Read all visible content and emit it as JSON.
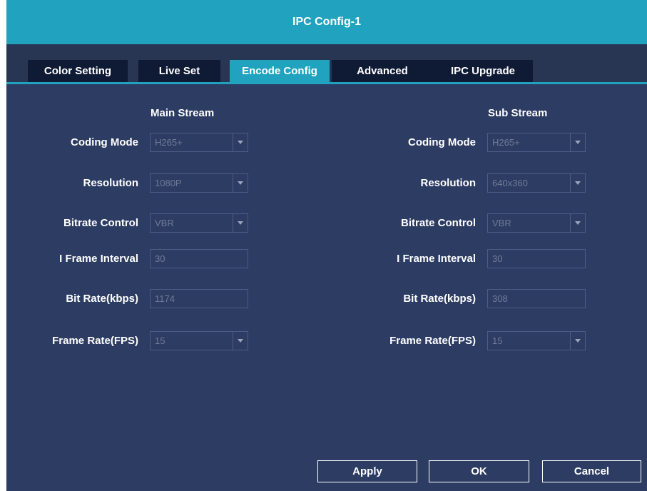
{
  "window": {
    "title": "IPC Config-1"
  },
  "tabs": [
    {
      "label": "Color Setting",
      "active": false
    },
    {
      "label": "Live Set",
      "active": false
    },
    {
      "label": "Encode Config",
      "active": true
    },
    {
      "label": "Advanced",
      "active": false
    },
    {
      "label": "IPC Upgrade",
      "active": false
    }
  ],
  "main": {
    "title": "Main Stream",
    "fields": [
      {
        "label": "Coding Mode",
        "value": "H265+",
        "kind": "select"
      },
      {
        "label": "Resolution",
        "value": "1080P",
        "kind": "select"
      },
      {
        "label": "Bitrate Control",
        "value": "VBR",
        "kind": "select"
      },
      {
        "label": "I Frame Interval",
        "value": "30",
        "kind": "input"
      },
      {
        "label": "Bit Rate(kbps)",
        "value": "1174",
        "kind": "input"
      },
      {
        "label": "Frame Rate(FPS)",
        "value": "15",
        "kind": "select"
      }
    ]
  },
  "sub": {
    "title": "Sub Stream",
    "fields": [
      {
        "label": "Coding Mode",
        "value": "H265+",
        "kind": "select"
      },
      {
        "label": "Resolution",
        "value": "640x360",
        "kind": "select"
      },
      {
        "label": "Bitrate Control",
        "value": "VBR",
        "kind": "select"
      },
      {
        "label": "I Frame Interval",
        "value": "30",
        "kind": "input"
      },
      {
        "label": "Bit Rate(kbps)",
        "value": "308",
        "kind": "input"
      },
      {
        "label": "Frame Rate(FPS)",
        "value": "15",
        "kind": "select"
      }
    ]
  },
  "buttons": {
    "apply": "Apply",
    "ok": "OK",
    "cancel": "Cancel"
  },
  "colors": {
    "accent": "#21a3bf",
    "panel": "#2c3c63",
    "tab_bg": "#0f1b35"
  },
  "icons": {
    "dropdown": "chevron-down-icon"
  }
}
